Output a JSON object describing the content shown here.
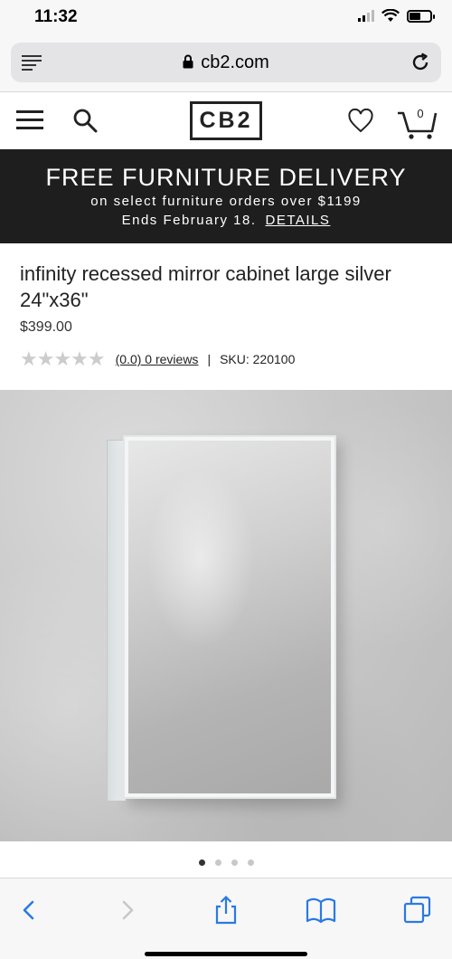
{
  "status_bar": {
    "time": "11:32",
    "icons": [
      "signal-icon",
      "wifi-icon",
      "battery-icon"
    ],
    "battery_level": 0.55
  },
  "browser": {
    "url": "cb2.com",
    "icons": [
      "reader-menu-icon",
      "lock-icon",
      "reload-icon"
    ]
  },
  "site_header": {
    "logo": "CB2",
    "cart_count": "0",
    "icons": [
      "hamburger-menu-icon",
      "search-icon",
      "heart-icon",
      "cart-icon"
    ]
  },
  "banner": {
    "title": "FREE FURNITURE DELIVERY",
    "line": "on select furniture orders over $1199",
    "ends": "Ends February 18.",
    "details_link": "DETAILS",
    "background": "#1e1e1e"
  },
  "product": {
    "title": "infinity recessed mirror cabinet large silver 24\"x36\"",
    "price": "$399.00",
    "rating_stars": "★★★★★",
    "rating_value": 0,
    "reviews_link": "(0.0) 0 reviews",
    "separator": "|",
    "sku": "SKU: 220100",
    "image_label": "mirror cabinet product photo"
  },
  "carousel": {
    "page_count": 4,
    "active_index": 0
  },
  "toolbar": {
    "icons": [
      "back-icon",
      "forward-icon",
      "share-icon",
      "bookmarks-icon",
      "tabs-icon"
    ],
    "accent": "#2a7ae2"
  }
}
